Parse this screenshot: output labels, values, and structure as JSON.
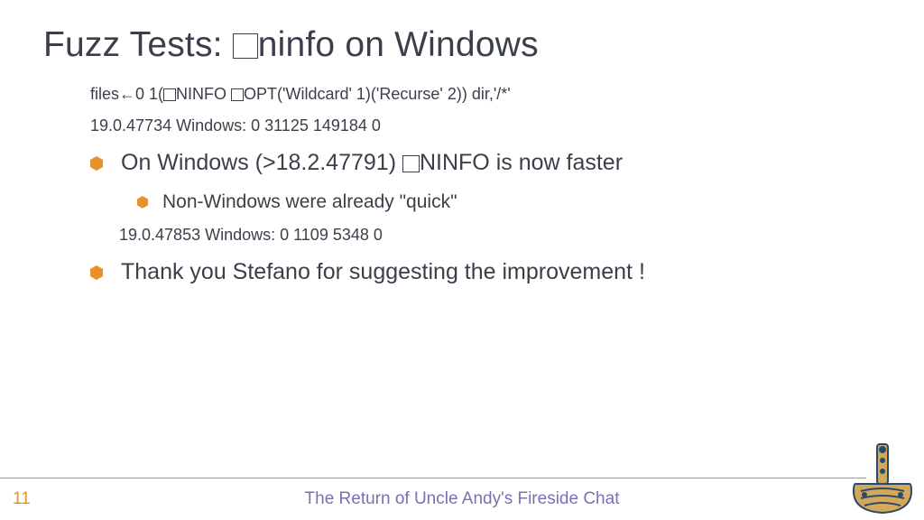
{
  "title_pre": "Fuzz Tests: ",
  "title_post": "ninfo on Windows",
  "code1_pre": "files←0 1(",
  "code1_mid1": "NINFO ",
  "code1_post": "OPT('Wildcard' 1)('Recurse' 2)) dir,'/*'",
  "code2": "19.0.47734 Windows:    0 31125 149184 0",
  "bullet1_pre": "On Windows (>18.2.47791) ",
  "bullet1_post": "NINFO is now faster",
  "sub1": "Non-Windows were already \"quick\"",
  "code3": "19.0.47853 Windows:    0 1109 5348 0",
  "bullet2": "Thank you Stefano for suggesting the improvement !",
  "page": "11",
  "footer": "The Return of Uncle Andy's Fireside Chat"
}
